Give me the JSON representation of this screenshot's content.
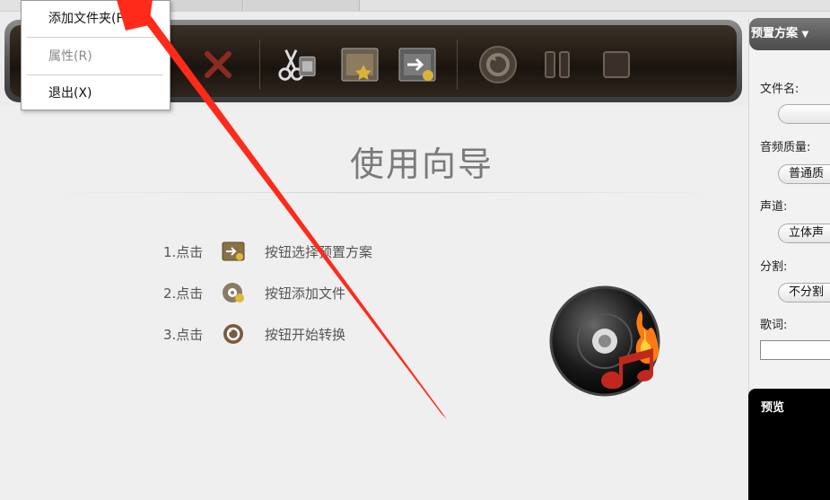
{
  "menu": {
    "items": [
      {
        "label": "添加文件夹(F)",
        "enabled": true
      },
      {
        "label": "属性(R)",
        "enabled": false
      },
      {
        "label": "退出(X)",
        "enabled": true
      }
    ]
  },
  "toolbar": {
    "buttons": [
      {
        "name": "delete",
        "icon": "delete-x-icon"
      },
      {
        "name": "clip",
        "icon": "scissors-film-icon"
      },
      {
        "name": "effect",
        "icon": "film-star-icon"
      },
      {
        "name": "merge",
        "icon": "film-arrow-icon"
      },
      {
        "name": "convert",
        "icon": "convert-disc-icon"
      },
      {
        "name": "pause",
        "icon": "pause-icon"
      },
      {
        "name": "stop",
        "icon": "stop-icon"
      }
    ]
  },
  "guide": {
    "title": "使用向导",
    "steps": [
      {
        "num": "1.点击",
        "text": "按钮选择预置方案",
        "icon": "preset-icon"
      },
      {
        "num": "2.点击",
        "text": "按钮添加文件",
        "icon": "add-file-disc-icon"
      },
      {
        "num": "3.点击",
        "text": "按钮开始转换",
        "icon": "convert-icon"
      }
    ]
  },
  "right_panel": {
    "preset_label": "预置方案",
    "filename_label": "文件名:",
    "filename_value": "",
    "audio_quality_label": "音频质量:",
    "audio_quality_value": "普通质",
    "channel_label": "声道:",
    "channel_value": "立体声",
    "split_label": "分割:",
    "split_value": "不分割",
    "lyrics_label": "歌词:",
    "preview_label": "预览"
  },
  "colors": {
    "toolbar_dark": "#231b14",
    "annotation_arrow": "#ff2a1a",
    "preview_bg": "#000000"
  }
}
